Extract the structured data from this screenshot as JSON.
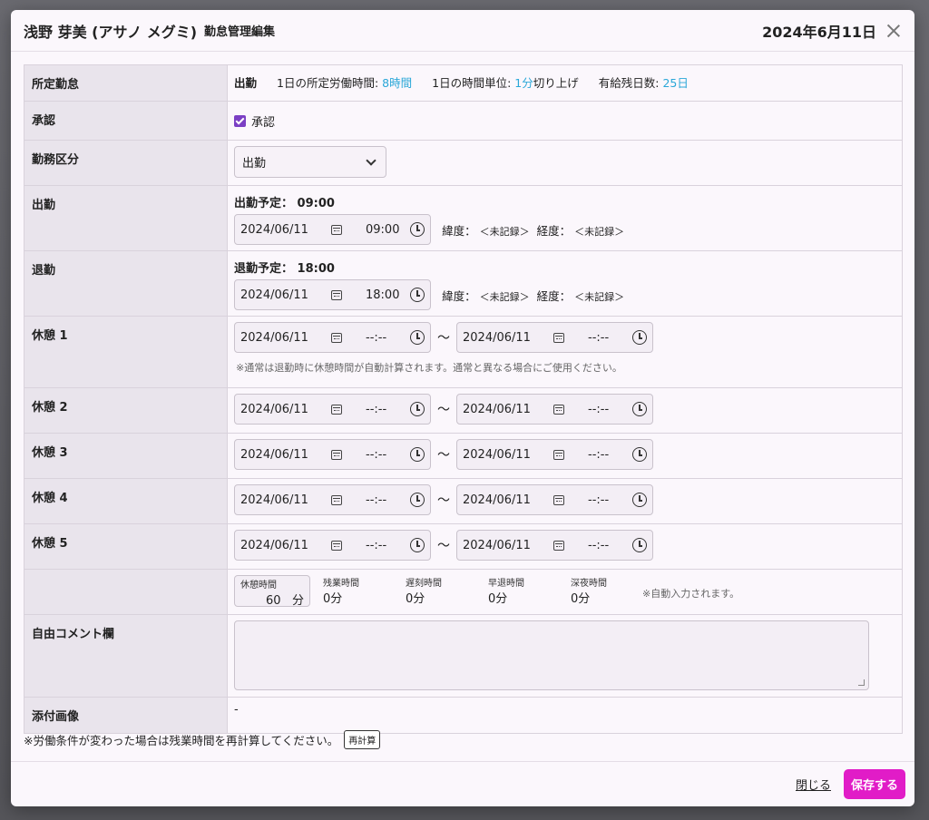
{
  "header": {
    "name": "浅野 芽美 (アサノ メグミ)",
    "subtitle": "勤怠管理編集",
    "date": "2024年6月11日"
  },
  "labels": {
    "schedule": "所定勤怠",
    "approval": "承認",
    "work_type": "勤務区分",
    "clock_in": "出勤",
    "clock_out": "退勤",
    "break1": "休憩 1",
    "break2": "休憩 2",
    "break3": "休憩 3",
    "break4": "休憩 4",
    "break5": "休憩 5",
    "comment": "自由コメント欄",
    "image": "添付画像"
  },
  "schedule": {
    "type": "出勤",
    "hours_label": "1日の所定労働時間:",
    "hours_value": "8時間",
    "unit_label": "1日の時間単位:",
    "unit_value": "1分",
    "unit_suffix": "切り上げ",
    "leave_label": "有給残日数:",
    "leave_value": "25日"
  },
  "approval": {
    "label": "承認",
    "checked": true
  },
  "work_type": {
    "selected": "出勤"
  },
  "clock_in": {
    "planned": "出勤予定： 09:00",
    "date": "2024/06/11",
    "time": "09:00"
  },
  "clock_out": {
    "planned": "退勤予定： 18:00",
    "date": "2024/06/11",
    "time": "18:00"
  },
  "geo": {
    "lat_label": "緯度：",
    "lng_label": "経度：",
    "not_recorded": "＜未記録＞"
  },
  "break_date": "2024/06/11",
  "break_time_empty": "--:--",
  "tilde": "〜",
  "break_note": "※通常は退勤時に休憩時間が自動計算されます。通常と異なる場合にご使用ください。",
  "summary": {
    "break_label": "休憩時間",
    "break_value": "60",
    "break_unit": "分",
    "overtime_label": "残業時間",
    "overtime_value": "0分",
    "late_label": "遅刻時間",
    "late_value": "0分",
    "early_label": "早退時間",
    "early_value": "0分",
    "night_label": "深夜時間",
    "night_value": "0分",
    "auto_note": "※自動入力されます。"
  },
  "image_value": "-",
  "footnote": "※労働条件が変わった場合は残業時間を再計算してください。",
  "recalc_label": "再計算",
  "footer": {
    "close": "閉じる",
    "save": "保存する"
  },
  "colors": {
    "accent": "#2aa7d8",
    "save_button": "#e11cc7",
    "checkbox": "#7b3fc4"
  }
}
